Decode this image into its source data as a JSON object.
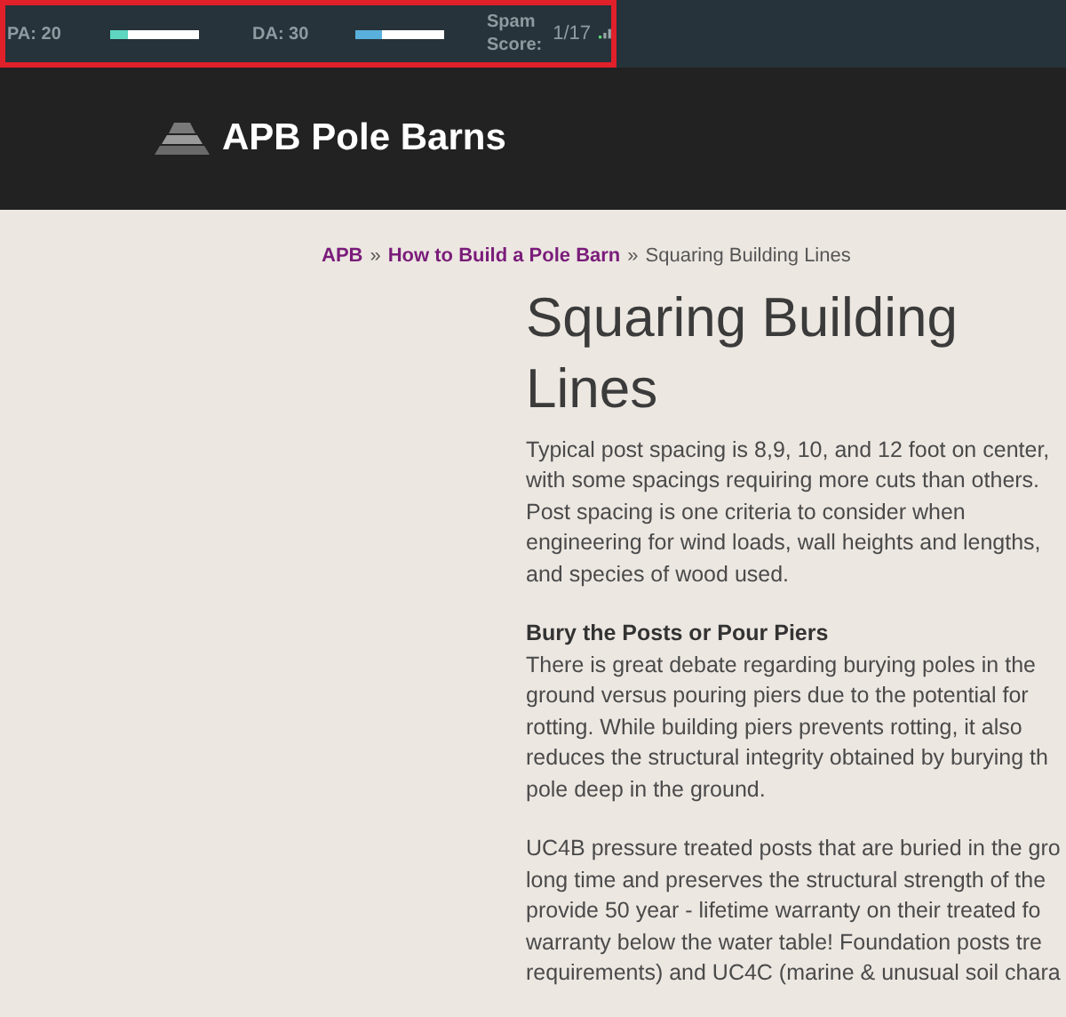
{
  "seo_toolbar": {
    "metrics": [
      {
        "label": "PA: 20",
        "level": 0.2,
        "color": "#5ed6c0"
      },
      {
        "label": "DA: 30",
        "level": 0.3,
        "color": "#5ab0dc"
      }
    ],
    "spam_label": "Spam Score:",
    "spam_value": "1/17"
  },
  "header": {
    "site_name": "APB Pole Barns"
  },
  "breadcrumb": {
    "links": [
      "APB",
      "How to Build a Pole Barn"
    ],
    "separator": "»",
    "current": "Squaring Building Lines"
  },
  "article": {
    "title": "Squaring Building Lines",
    "blocks": [
      {
        "kind": "paragraph",
        "lines": [
          "Typical post spacing is 8,9, 10, and 12 foot on center,",
          "with some spacings requiring more cuts than others.",
          "Post spacing is one criteria to consider when",
          "engineering for wind loads, wall heights and lengths,",
          "and species of wood used."
        ]
      },
      {
        "kind": "paragraph",
        "heading": "Bury the Posts or Pour Piers",
        "lines": [
          "There is great debate regarding burying poles in the",
          "ground versus pouring piers due to the potential for",
          "rotting. While building piers prevents rotting, it also",
          "reduces the structural integrity obtained by burying th",
          "pole deep in the ground."
        ]
      },
      {
        "kind": "paragraph",
        "lines": [
          "UC4B pressure treated posts that are buried in the gro",
          "long time and preserves the structural strength of the",
          "provide 50 year - lifetime warranty on their treated fo",
          "warranty below the water table! Foundation posts tre",
          "requirements) and UC4C (marine & unusual soil chara"
        ]
      }
    ]
  }
}
